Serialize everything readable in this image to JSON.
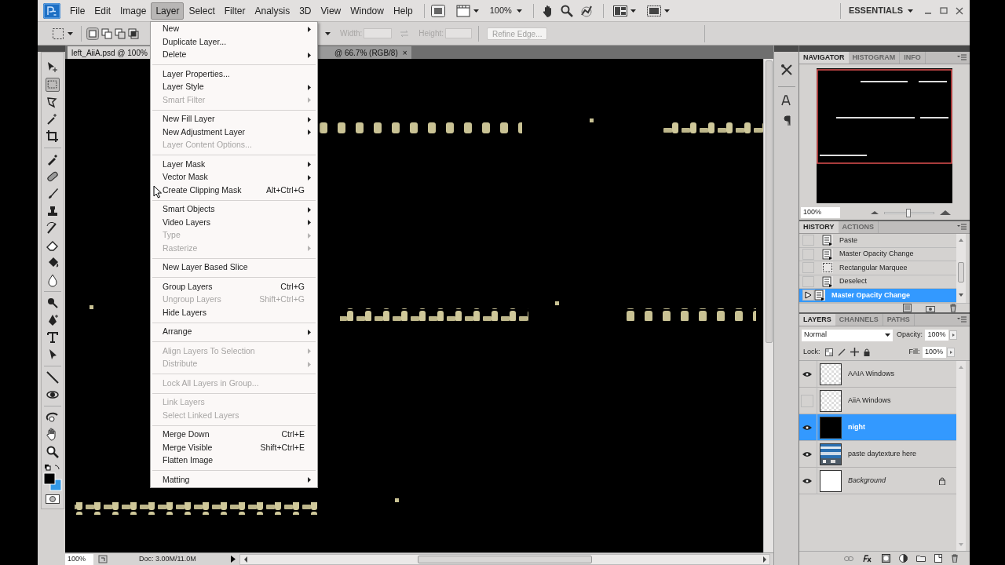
{
  "menubar": {
    "items": [
      {
        "label": "File",
        "selected": false
      },
      {
        "label": "Edit",
        "selected": false
      },
      {
        "label": "Image",
        "selected": false
      },
      {
        "label": "Layer",
        "selected": true
      },
      {
        "label": "Select",
        "selected": false
      },
      {
        "label": "Filter",
        "selected": false
      },
      {
        "label": "Analysis",
        "selected": false
      },
      {
        "label": "3D",
        "selected": false
      },
      {
        "label": "View",
        "selected": false
      },
      {
        "label": "Window",
        "selected": false
      },
      {
        "label": "Help",
        "selected": false
      }
    ],
    "zoom": "100%",
    "workspace": "ESSENTIALS"
  },
  "options_bar": {
    "width_label": "Width:",
    "height_label": "Height:",
    "refine_button": "Refine Edge..."
  },
  "document_tabs": [
    {
      "label": "left_AiiA.psd @ 100%",
      "selected": true
    },
    {
      "label": "@ 66.7% (RGB/8)",
      "close": "×",
      "selected": false
    }
  ],
  "layer_menu": [
    {
      "kind": "item",
      "label": "New",
      "disabled": false,
      "submenu": true
    },
    {
      "kind": "item",
      "label": "Duplicate Layer...",
      "disabled": false,
      "submenu": false
    },
    {
      "kind": "item",
      "label": "Delete",
      "disabled": false,
      "submenu": true
    },
    {
      "kind": "separator"
    },
    {
      "kind": "item",
      "label": "Layer Properties...",
      "disabled": false,
      "submenu": false
    },
    {
      "kind": "item",
      "label": "Layer Style",
      "disabled": false,
      "submenu": true
    },
    {
      "kind": "item",
      "label": "Smart Filter",
      "disabled": true,
      "submenu": true
    },
    {
      "kind": "separator"
    },
    {
      "kind": "item",
      "label": "New Fill Layer",
      "disabled": false,
      "submenu": true
    },
    {
      "kind": "item",
      "label": "New Adjustment Layer",
      "disabled": false,
      "submenu": true
    },
    {
      "kind": "item",
      "label": "Layer Content Options...",
      "disabled": true,
      "submenu": false
    },
    {
      "kind": "separator"
    },
    {
      "kind": "item",
      "label": "Layer Mask",
      "disabled": false,
      "submenu": true
    },
    {
      "kind": "item",
      "label": "Vector Mask",
      "disabled": false,
      "submenu": true
    },
    {
      "kind": "item",
      "label": "Create Clipping Mask",
      "shortcut": "Alt+Ctrl+G",
      "disabled": false,
      "submenu": false
    },
    {
      "kind": "separator"
    },
    {
      "kind": "item",
      "label": "Smart Objects",
      "disabled": false,
      "submenu": true
    },
    {
      "kind": "item",
      "label": "Video Layers",
      "disabled": false,
      "submenu": true
    },
    {
      "kind": "item",
      "label": "Type",
      "disabled": true,
      "submenu": true
    },
    {
      "kind": "item",
      "label": "Rasterize",
      "disabled": true,
      "submenu": true
    },
    {
      "kind": "separator"
    },
    {
      "kind": "item",
      "label": "New Layer Based Slice",
      "disabled": false,
      "submenu": false
    },
    {
      "kind": "separator"
    },
    {
      "kind": "item",
      "label": "Group Layers",
      "shortcut": "Ctrl+G",
      "disabled": false,
      "submenu": false
    },
    {
      "kind": "item",
      "label": "Ungroup Layers",
      "shortcut": "Shift+Ctrl+G",
      "disabled": true,
      "submenu": false
    },
    {
      "kind": "item",
      "label": "Hide Layers",
      "disabled": false,
      "submenu": false
    },
    {
      "kind": "separator"
    },
    {
      "kind": "item",
      "label": "Arrange",
      "disabled": false,
      "submenu": true
    },
    {
      "kind": "separator"
    },
    {
      "kind": "item",
      "label": "Align Layers To Selection",
      "disabled": true,
      "submenu": true
    },
    {
      "kind": "item",
      "label": "Distribute",
      "disabled": true,
      "submenu": true
    },
    {
      "kind": "separator"
    },
    {
      "kind": "item",
      "label": "Lock All Layers in Group...",
      "disabled": true,
      "submenu": false
    },
    {
      "kind": "separator"
    },
    {
      "kind": "item",
      "label": "Link Layers",
      "disabled": true,
      "submenu": false
    },
    {
      "kind": "item",
      "label": "Select Linked Layers",
      "disabled": true,
      "submenu": false
    },
    {
      "kind": "separator"
    },
    {
      "kind": "item",
      "label": "Merge Down",
      "shortcut": "Ctrl+E",
      "disabled": false,
      "submenu": false
    },
    {
      "kind": "item",
      "label": "Merge Visible",
      "shortcut": "Shift+Ctrl+E",
      "disabled": false,
      "submenu": false
    },
    {
      "kind": "item",
      "label": "Flatten Image",
      "disabled": false,
      "submenu": false
    },
    {
      "kind": "separator"
    },
    {
      "kind": "item",
      "label": "Matting",
      "disabled": false,
      "submenu": true
    }
  ],
  "navigator": {
    "tabs": [
      {
        "label": "NAVIGATOR",
        "selected": true
      },
      {
        "label": "HISTOGRAM",
        "selected": false
      },
      {
        "label": "INFO",
        "selected": false
      }
    ],
    "zoom": "100%",
    "level": 0.48
  },
  "history": {
    "tabs": [
      {
        "label": "HISTORY",
        "selected": true
      },
      {
        "label": "ACTIONS",
        "selected": false
      }
    ],
    "items": [
      {
        "label": "Paste",
        "kind": "document",
        "selected": false
      },
      {
        "label": "Master Opacity Change",
        "kind": "document",
        "selected": false
      },
      {
        "label": "Rectangular Marquee",
        "kind": "marquee",
        "selected": false
      },
      {
        "label": "Deselect",
        "kind": "document",
        "selected": false
      },
      {
        "label": "Master Opacity Change",
        "kind": "document",
        "selected": true
      }
    ]
  },
  "layers": {
    "tabs": [
      {
        "label": "LAYERS",
        "selected": true
      },
      {
        "label": "CHANNELS",
        "selected": false
      },
      {
        "label": "PATHS",
        "selected": false
      }
    ],
    "blend_mode": "Normal",
    "opacity_label": "Opacity:",
    "opacity": "100%",
    "lock_label": "Lock:",
    "fill_label": "Fill:",
    "fill": "100%",
    "items": [
      {
        "name": "AAIA Windows",
        "visible": true,
        "selected": false,
        "kind": "transparent",
        "locked": false
      },
      {
        "name": "AiiA Windows",
        "visible": false,
        "selected": false,
        "kind": "transparent",
        "locked": false
      },
      {
        "name": "night",
        "visible": true,
        "selected": true,
        "kind": "black",
        "locked": false
      },
      {
        "name": "paste daytexture here",
        "visible": true,
        "selected": false,
        "locked": false
      },
      {
        "name": "Background",
        "visible": true,
        "selected": false,
        "kind": "white",
        "locked": true
      }
    ]
  },
  "status_bar": {
    "zoom": "100%",
    "doc_info": "Doc: 3.00M/11.0M"
  }
}
